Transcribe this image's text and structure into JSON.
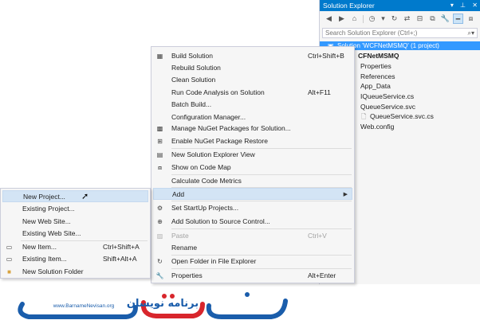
{
  "solution_explorer": {
    "title": "Solution Explorer",
    "title_buttons": [
      "▾",
      "⊥",
      "✕"
    ],
    "search_placeholder": "Search Solution Explorer (Ctrl+;)",
    "solution_label": "Solution 'WCFNetMSMQ' (1 project)",
    "project_label": "CFNetMSMQ",
    "items": [
      "Properties",
      "References",
      "App_Data",
      "IQueueService.cs",
      "QueueService.svc",
      "QueueService.svc.cs",
      "Web.config"
    ]
  },
  "context_menu": {
    "items": [
      {
        "label": "Build Solution",
        "shortcut": "Ctrl+Shift+B"
      },
      {
        "label": "Rebuild Solution",
        "shortcut": ""
      },
      {
        "label": "Clean Solution",
        "shortcut": ""
      },
      {
        "label": "Run Code Analysis on Solution",
        "shortcut": "Alt+F11"
      },
      {
        "label": "Batch Build...",
        "shortcut": ""
      },
      {
        "label": "Configuration Manager...",
        "shortcut": ""
      },
      {
        "label": "Manage NuGet Packages for Solution...",
        "shortcut": ""
      },
      {
        "label": "Enable NuGet Package Restore",
        "shortcut": ""
      },
      {
        "label": "New Solution Explorer View",
        "shortcut": ""
      },
      {
        "label": "Show on Code Map",
        "shortcut": ""
      },
      {
        "label": "Calculate Code Metrics",
        "shortcut": ""
      },
      {
        "label": "Add",
        "shortcut": ""
      },
      {
        "label": "Set StartUp Projects...",
        "shortcut": ""
      },
      {
        "label": "Add Solution to Source Control...",
        "shortcut": ""
      },
      {
        "label": "Paste",
        "shortcut": "Ctrl+V"
      },
      {
        "label": "Rename",
        "shortcut": ""
      },
      {
        "label": "Open Folder in File Explorer",
        "shortcut": ""
      },
      {
        "label": "Properties",
        "shortcut": "Alt+Enter"
      }
    ]
  },
  "add_submenu": {
    "items": [
      {
        "label": "New Project...",
        "shortcut": ""
      },
      {
        "label": "Existing Project...",
        "shortcut": ""
      },
      {
        "label": "New Web Site...",
        "shortcut": ""
      },
      {
        "label": "Existing Web Site...",
        "shortcut": ""
      },
      {
        "label": "New Item...",
        "shortcut": "Ctrl+Shift+A"
      },
      {
        "label": "Existing Item...",
        "shortcut": "Shift+Alt+A"
      },
      {
        "label": "New Solution Folder",
        "shortcut": ""
      }
    ]
  },
  "watermark": {
    "url_text": "www.BarnameNevisan.org",
    "brand_text": "برنامه نویسان"
  },
  "colors": {
    "accent": "#007acc",
    "selection": "#3399ff",
    "highlight": "#d3e4f5",
    "logo_blue": "#1a5dab",
    "logo_red": "#d8262c"
  }
}
